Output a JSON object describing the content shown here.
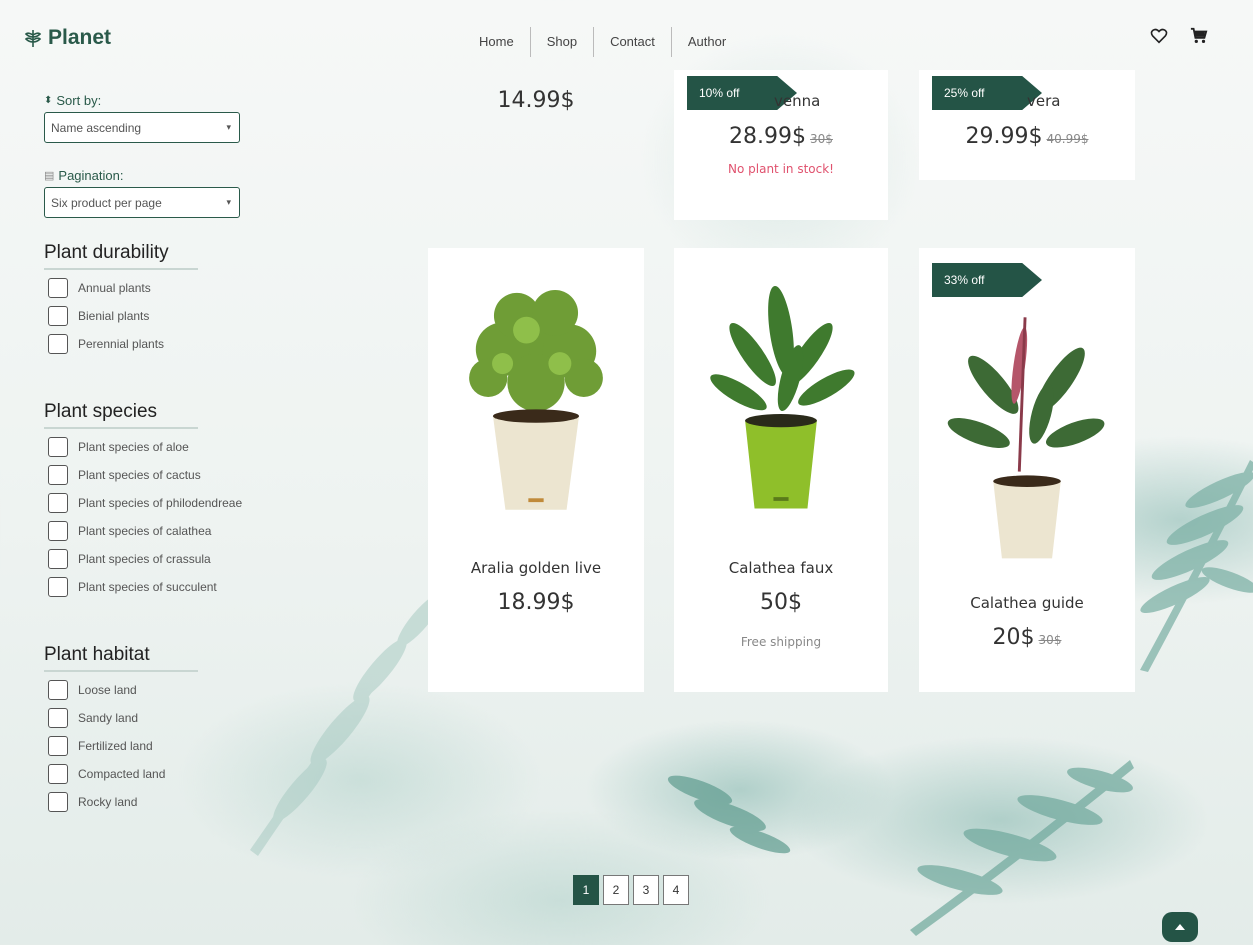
{
  "header": {
    "logo": "Planet",
    "nav": [
      "Home",
      "Shop",
      "Contact",
      "Author"
    ]
  },
  "sidebar": {
    "sort_label": "Sort by:",
    "sort_value": "Name ascending",
    "pagination_label": "Pagination:",
    "pagination_value": "Six product per page",
    "durability": {
      "title": "Plant durability",
      "items": [
        "Annual plants",
        "Bienial plants",
        "Perennial plants"
      ]
    },
    "species": {
      "title": "Plant species",
      "items": [
        "Plant species of aloe",
        "Plant species of cactus",
        "Plant species of philodendreae",
        "Plant species of calathea",
        "Plant species of crassula",
        "Plant species of succulent"
      ]
    },
    "habitat": {
      "title": "Plant habitat",
      "items": [
        "Loose land",
        "Sandy land",
        "Fertilized land",
        "Compacted land",
        "Rocky land"
      ]
    }
  },
  "products_top": [
    {
      "price": "14.99$"
    },
    {
      "badge": "10% off",
      "name_partial": "venna",
      "price": "28.99$",
      "old_price": "30$",
      "note": "No plant in stock!"
    },
    {
      "badge": "25% off",
      "name_partial": "vera",
      "price": "29.99$",
      "old_price": "40.99$"
    }
  ],
  "products": [
    {
      "name": "Aralia golden live",
      "price": "18.99$"
    },
    {
      "name": "Calathea faux",
      "price": "50$",
      "note": "Free shipping"
    },
    {
      "badge": "33% off",
      "name": "Calathea guide",
      "price": "20$",
      "old_price": "30$"
    }
  ],
  "pagination": {
    "pages": [
      "1",
      "2",
      "3",
      "4"
    ],
    "active": "1"
  },
  "colors": {
    "brand": "#245446",
    "out_of_stock": "#e0526e",
    "note_gray": "#888888"
  }
}
